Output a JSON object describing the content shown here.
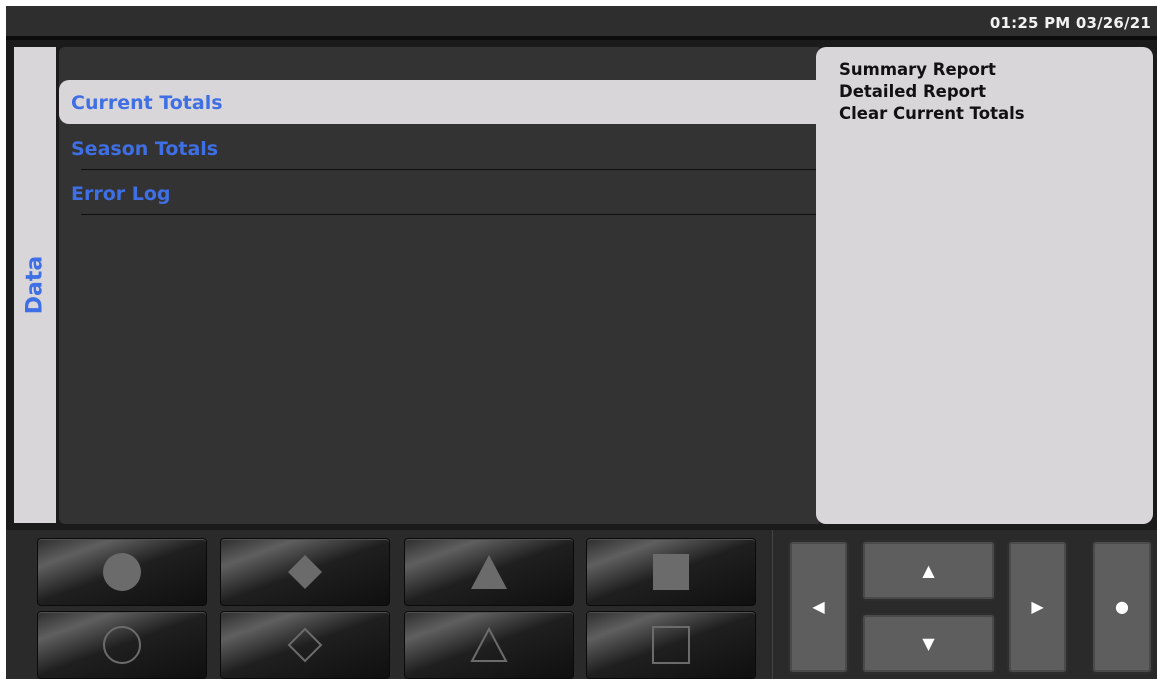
{
  "status_bar": {
    "datetime": "01:25 PM 03/26/21"
  },
  "side_tab": {
    "label": "Data"
  },
  "menu": {
    "items": [
      {
        "label": "Current Totals",
        "selected": true
      },
      {
        "label": "Season Totals",
        "selected": false
      },
      {
        "label": "Error Log",
        "selected": false
      }
    ]
  },
  "actions": {
    "items": [
      {
        "label": "Summary Report"
      },
      {
        "label": "Detailed Report"
      },
      {
        "label": "Clear Current Totals"
      }
    ]
  },
  "softkeys": [
    {
      "icon": "filled-circle-icon"
    },
    {
      "icon": "filled-diamond-icon"
    },
    {
      "icon": "filled-triangle-icon"
    },
    {
      "icon": "filled-square-icon"
    },
    {
      "icon": "outline-circle-icon"
    },
    {
      "icon": "outline-diamond-icon"
    },
    {
      "icon": "outline-triangle-icon"
    },
    {
      "icon": "outline-square-icon"
    }
  ],
  "navigation": {
    "left": "◀",
    "up": "▲",
    "down": "▼",
    "right": "▶",
    "select": "●"
  },
  "colors": {
    "accent": "#3e6fe4",
    "panel": "#d9d6d9",
    "background": "#333333"
  }
}
